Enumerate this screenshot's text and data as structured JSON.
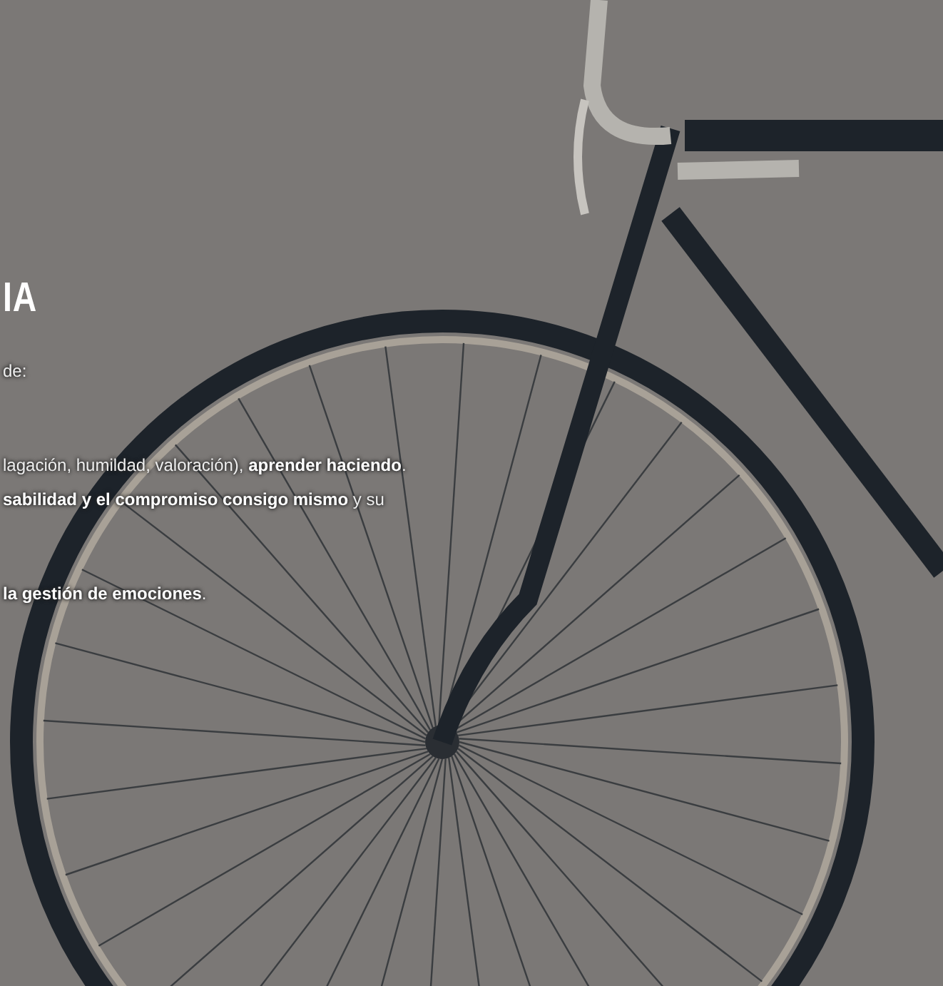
{
  "section": {
    "heading": "IA",
    "paragraphs": [
      [
        "de:"
      ],
      [
        "lagación, humildad, valoración), **aprender haciendo**.",
        "**sabilidad y el compromiso consigo mismo** y su"
      ],
      [
        "**la gestión de emociones**."
      ]
    ]
  }
}
